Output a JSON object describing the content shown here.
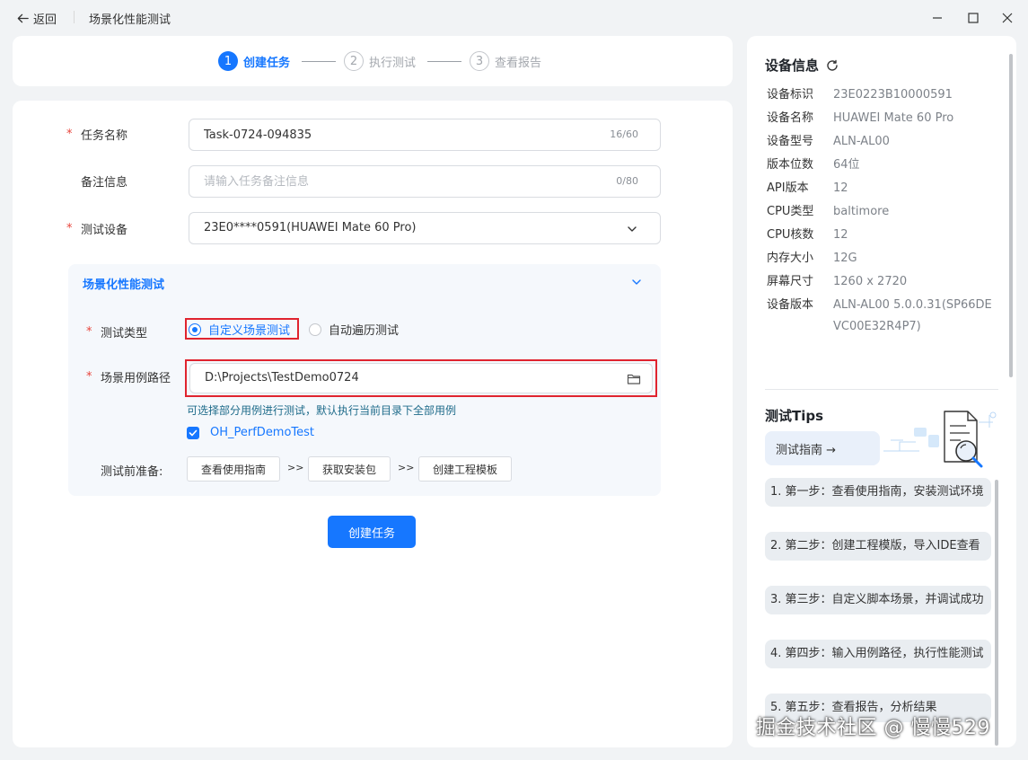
{
  "titlebar": {
    "back_label": "返回",
    "page_title": "场景化性能测试"
  },
  "stepper": {
    "steps": [
      {
        "num": "1",
        "label": "创建任务",
        "state": "active"
      },
      {
        "num": "2",
        "label": "执行测试",
        "state": "inactive"
      },
      {
        "num": "3",
        "label": "查看报告",
        "state": "inactive"
      }
    ]
  },
  "form": {
    "required_mark": "*",
    "task_name": {
      "label": "任务名称",
      "value": "Task-0724-094835",
      "counter": "16/60"
    },
    "remark": {
      "label": "备注信息",
      "placeholder": "请输入任务备注信息",
      "counter": "0/80"
    },
    "device": {
      "label": "测试设备",
      "value": "23E0****0591(HUAWEI Mate 60 Pro)"
    },
    "scene": {
      "title": "场景化性能测试",
      "test_type_label": "测试类型",
      "options": [
        "自定义场景测试",
        "自动遍历测试"
      ],
      "selected_option": "自定义场景测试",
      "path_label": "场景用例路径",
      "path_value": "D:\\Projects\\TestDemo0724",
      "hint": "可选择部分用例进行测试，默认执行当前目录下全部用例",
      "case_checkbox": "OH_PerfDemoTest",
      "prep_label": "测试前准备:",
      "prep_buttons": [
        "查看使用指南",
        "获取安装包",
        "创建工程模板"
      ],
      "arrow": ">>"
    },
    "submit_label": "创建任务"
  },
  "device_info": {
    "title": "设备信息",
    "rows": [
      {
        "key": "设备标识",
        "value": "23E0223B10000591"
      },
      {
        "key": "设备名称",
        "value": "HUAWEI Mate 60 Pro"
      },
      {
        "key": "设备型号",
        "value": "ALN-AL00"
      },
      {
        "key": "版本位数",
        "value": "64位"
      },
      {
        "key": "API版本",
        "value": "12"
      },
      {
        "key": "CPU类型",
        "value": "baltimore"
      },
      {
        "key": "CPU核数",
        "value": "12"
      },
      {
        "key": "内存大小",
        "value": "12G"
      },
      {
        "key": "屏幕尺寸",
        "value": "1260 x 2720"
      },
      {
        "key": "设备版本",
        "value": "ALN-AL00 5.0.0.31(SP66DEVC00E32R4P7)"
      }
    ]
  },
  "tips": {
    "title": "测试Tips",
    "guide_label": "测试指南 →",
    "items": [
      "1. 第一步：查看使用指南，安装测试环境",
      "2. 第二步：创建工程模版，导入IDE查看",
      "3. 第三步：自定义脚本场景，并调试成功",
      "4. 第四步：输入用例路径，执行性能测试",
      "5. 第五步：查看报告，分析结果"
    ]
  },
  "watermark": "掘金技术社区 @ 慢慢529",
  "colors": {
    "accent": "#1677ff",
    "required": "#e8453c",
    "highlight": "#e0242f"
  }
}
